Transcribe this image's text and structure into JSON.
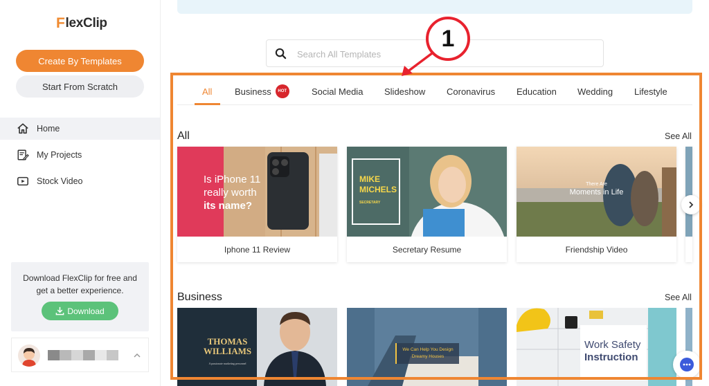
{
  "app": {
    "logo_text": "lexClip",
    "logo_f": "F"
  },
  "sidebar": {
    "create_label": "Create By Templates",
    "scratch_label": "Start From Scratch",
    "nav": [
      {
        "label": "Home",
        "icon": "home-icon"
      },
      {
        "label": "My Projects",
        "icon": "projects-icon"
      },
      {
        "label": "Stock Video",
        "icon": "video-icon"
      }
    ],
    "promo_text": "Download FlexClip for free and get a better experience.",
    "download_label": "Download"
  },
  "search": {
    "placeholder": "Search All Templates"
  },
  "annotation": {
    "number": "1"
  },
  "tabs": [
    "All",
    "Business",
    "Social Media",
    "Slideshow",
    "Coronavirus",
    "Education",
    "Wedding",
    "Lifestyle"
  ],
  "hot_badge": "HOT",
  "sections": {
    "all": {
      "title": "All",
      "see_all": "See All",
      "cards": [
        {
          "caption": "Iphone 11 Review",
          "thumb_line1": "Is iPhone 11",
          "thumb_line2": "really worth",
          "thumb_line3": "its name?"
        },
        {
          "caption": "Secretary Resume",
          "thumb_line1": "MIKE",
          "thumb_line2": "MICHELS",
          "thumb_line3": "SECRETARY"
        },
        {
          "caption": "Friendship Video",
          "thumb_line1": "There Are",
          "thumb_line2": "Moments in Life"
        }
      ]
    },
    "business": {
      "title": "Business",
      "see_all": "See All",
      "cards": [
        {
          "thumb_line1": "THOMAS",
          "thumb_line2": "WILLIAMS",
          "thumb_line3": "A passionate marketing personnel"
        },
        {
          "thumb_line1": "We Can Help You Design",
          "thumb_line2": "Dreamy Houses"
        },
        {
          "thumb_line1": "Work Safety",
          "thumb_line2": "Instruction"
        }
      ]
    }
  },
  "colors": {
    "accent": "#ef8632",
    "download": "#5cc27a",
    "annotation": "#e8222e",
    "hot": "#d7262c"
  }
}
